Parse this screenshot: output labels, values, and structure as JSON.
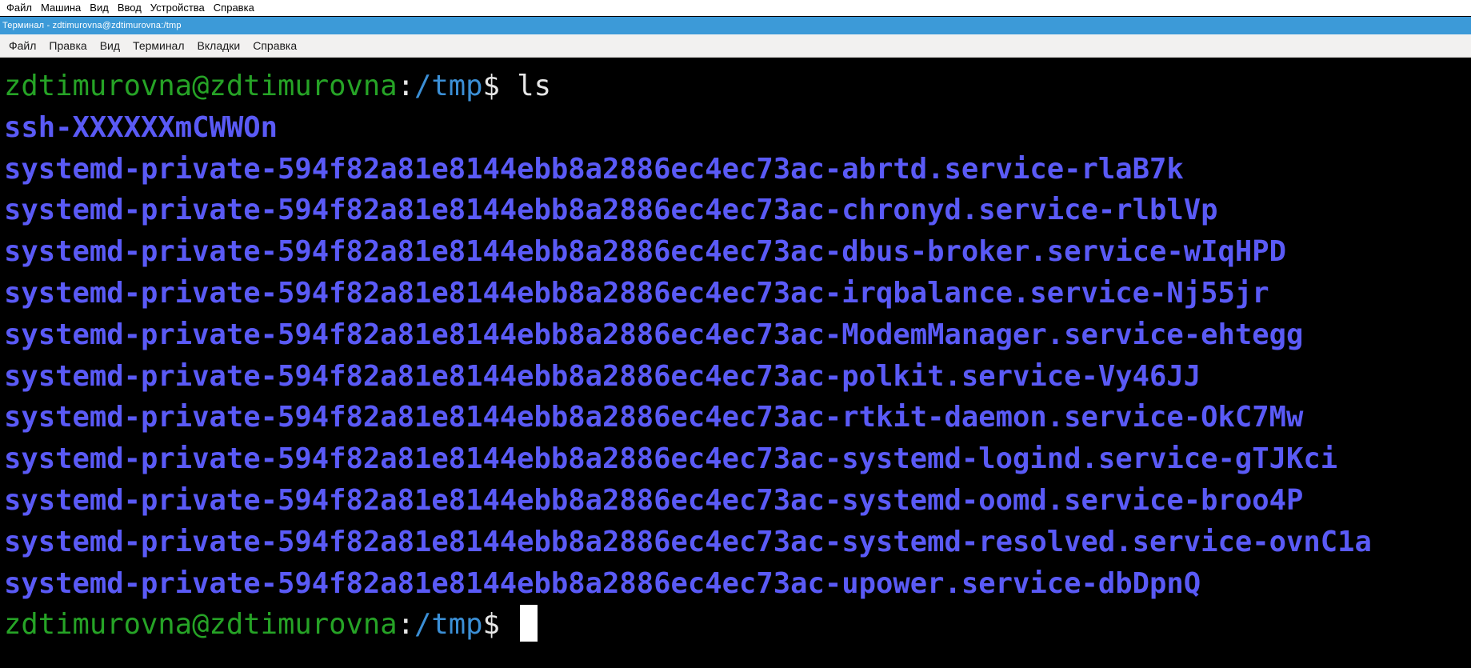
{
  "host_menu": {
    "items": [
      "Файл",
      "Машина",
      "Вид",
      "Ввод",
      "Устройства",
      "Справка"
    ]
  },
  "window": {
    "title": "Терминал - zdtimurovna@zdtimurovna:/tmp"
  },
  "app_menu": {
    "items": [
      "Файл",
      "Правка",
      "Вид",
      "Терминал",
      "Вкладки",
      "Справка"
    ]
  },
  "terminal": {
    "prompt1": {
      "user_host": "zdtimurovna@zdtimurovna",
      "sep": ":",
      "path": "/tmp",
      "sign": "$",
      "command": " ls"
    },
    "listing": [
      "ssh-XXXXXXmCWWOn",
      "systemd-private-594f82a81e8144ebb8a2886ec4ec73ac-abrtd.service-rlaB7k",
      "systemd-private-594f82a81e8144ebb8a2886ec4ec73ac-chronyd.service-rlblVp",
      "systemd-private-594f82a81e8144ebb8a2886ec4ec73ac-dbus-broker.service-wIqHPD",
      "systemd-private-594f82a81e8144ebb8a2886ec4ec73ac-irqbalance.service-Nj55jr",
      "systemd-private-594f82a81e8144ebb8a2886ec4ec73ac-ModemManager.service-ehtegg",
      "systemd-private-594f82a81e8144ebb8a2886ec4ec73ac-polkit.service-Vy46JJ",
      "systemd-private-594f82a81e8144ebb8a2886ec4ec73ac-rtkit-daemon.service-OkC7Mw",
      "systemd-private-594f82a81e8144ebb8a2886ec4ec73ac-systemd-logind.service-gTJKci",
      "systemd-private-594f82a81e8144ebb8a2886ec4ec73ac-systemd-oomd.service-broo4P",
      "systemd-private-594f82a81e8144ebb8a2886ec4ec73ac-systemd-resolved.service-ovnC1a",
      "systemd-private-594f82a81e8144ebb8a2886ec4ec73ac-upower.service-dbDpnQ"
    ],
    "prompt2": {
      "user_host": "zdtimurovna@zdtimurovna",
      "sep": ":",
      "path": "/tmp",
      "sign": "$ ",
      "command": ""
    },
    "colors": {
      "background": "#000000",
      "prompt_user": "#26a326",
      "prompt_path": "#3b8fd6",
      "directory": "#5a5af6",
      "text": "#e6e6e6",
      "cursor": "#ffffff"
    }
  }
}
